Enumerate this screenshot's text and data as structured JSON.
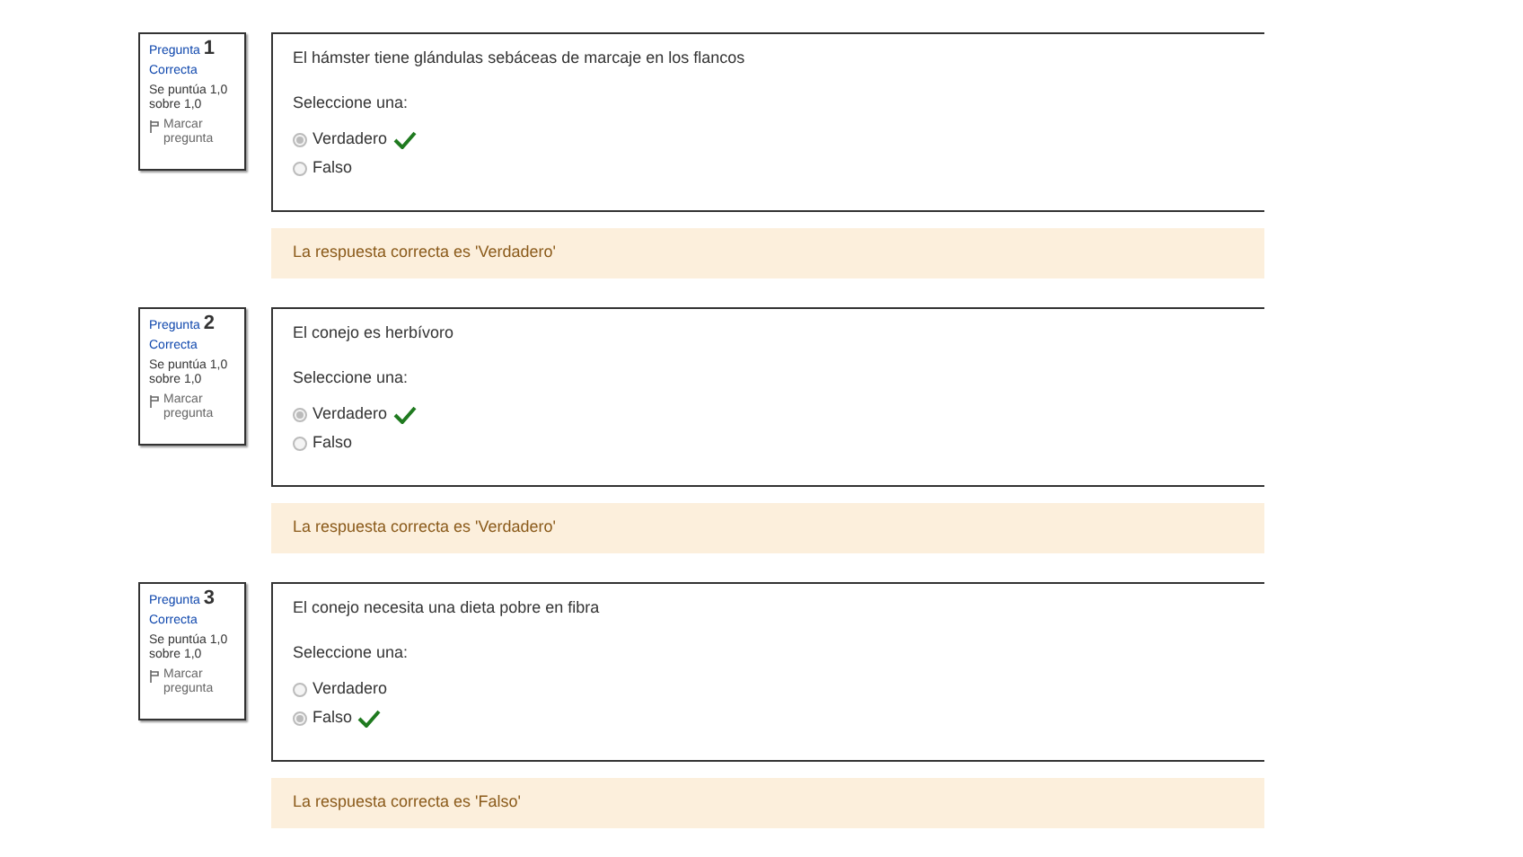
{
  "questions": [
    {
      "label": "Pregunta",
      "number": "1",
      "status": "Correcta",
      "score": "Se puntúa 1,0 sobre 1,0",
      "flag": "Marcar pregunta",
      "text": "El hámster tiene glándulas sebáceas de marcaje en los flancos",
      "prompt": "Seleccione una:",
      "options": [
        {
          "label": "Verdadero",
          "selected": true,
          "correct": true
        },
        {
          "label": "Falso",
          "selected": false,
          "correct": false
        }
      ],
      "feedback": "La respuesta correcta es 'Verdadero'"
    },
    {
      "label": "Pregunta",
      "number": "2",
      "status": "Correcta",
      "score": "Se puntúa 1,0 sobre 1,0",
      "flag": "Marcar pregunta",
      "text": "El conejo es herbívoro",
      "prompt": "Seleccione una:",
      "options": [
        {
          "label": "Verdadero",
          "selected": true,
          "correct": true
        },
        {
          "label": "Falso",
          "selected": false,
          "correct": false
        }
      ],
      "feedback": "La respuesta correcta es 'Verdadero'"
    },
    {
      "label": "Pregunta",
      "number": "3",
      "status": "Correcta",
      "score": "Se puntúa 1,0 sobre 1,0",
      "flag": "Marcar pregunta",
      "text": "El conejo necesita una dieta pobre en fibra",
      "prompt": "Seleccione una:",
      "options": [
        {
          "label": "Verdadero",
          "selected": false,
          "correct": false
        },
        {
          "label": "Falso",
          "selected": true,
          "correct": true
        }
      ],
      "feedback": "La respuesta correcta es 'Falso'"
    }
  ]
}
